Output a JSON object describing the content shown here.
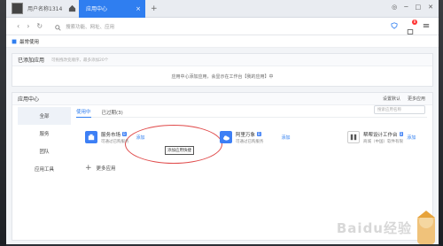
{
  "tabbar": {
    "user": "用户名称1314",
    "tab_label": "应用中心",
    "close": "×",
    "add": "+"
  },
  "addrbar": {
    "placeholder": "搜索功能、网址、应用",
    "badge": "8"
  },
  "bookmarks": {
    "label": "最常使用"
  },
  "added_panel": {
    "title": "已添加应用",
    "subtitle": "可拖拽改变顺序，最多添加20个",
    "empty_msg": "应用中心添加应用，会显示在工作台【我的应用】中"
  },
  "center": {
    "title": "应用中心",
    "links": [
      "设置默认",
      "更多应用"
    ],
    "sidebar": [
      "全部",
      "服务",
      "团队",
      "应用工具"
    ],
    "subtabs": [
      "使用中",
      "已过期(3)"
    ],
    "search_placeholder": "搜索应用名称",
    "apps": [
      {
        "name": "服务市场",
        "badge": "B",
        "desc": "可通过已购服务",
        "add": "添加"
      },
      {
        "name": "阿里万象",
        "badge": "B",
        "desc": "可通过已购服务",
        "add": "添加"
      },
      {
        "name": "帮帮设计工作台",
        "badge": "B",
        "desc": "商城（中国）软件有限",
        "add": "添加"
      }
    ],
    "tooltip": "添加应用快捷",
    "more": "更多应用"
  },
  "watermark": "Baidu经验",
  "colors": {
    "accent": "#2f7ef0",
    "highlight": "#e04a4a"
  }
}
